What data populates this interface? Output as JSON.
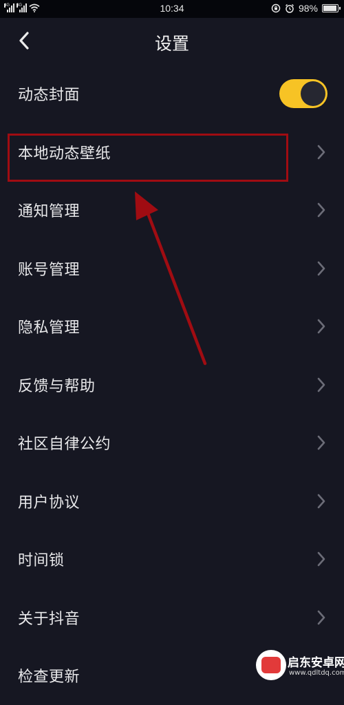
{
  "status_bar": {
    "time": "10:34",
    "network_left": "4G",
    "network_right": "3G",
    "battery_text": "98%",
    "battery_level": 0.98
  },
  "header": {
    "title": "设置",
    "back_icon": "chevron-left-icon"
  },
  "settings": {
    "dynamic_cover": {
      "label": "动态封面",
      "enabled": true
    },
    "items": [
      {
        "label": "本地动态壁纸"
      },
      {
        "label": "通知管理"
      },
      {
        "label": "账号管理"
      },
      {
        "label": "隐私管理"
      },
      {
        "label": "反馈与帮助"
      },
      {
        "label": "社区自律公约"
      },
      {
        "label": "用户协议"
      },
      {
        "label": "时间锁"
      },
      {
        "label": "关于抖音"
      },
      {
        "label": "检查更新"
      }
    ]
  },
  "colors": {
    "background": "#161722",
    "toggle_on": "#f7c325",
    "annotation": "#a00c12"
  },
  "watermark": {
    "name": "启东安卓网",
    "url": "www.qdltdq.com"
  }
}
